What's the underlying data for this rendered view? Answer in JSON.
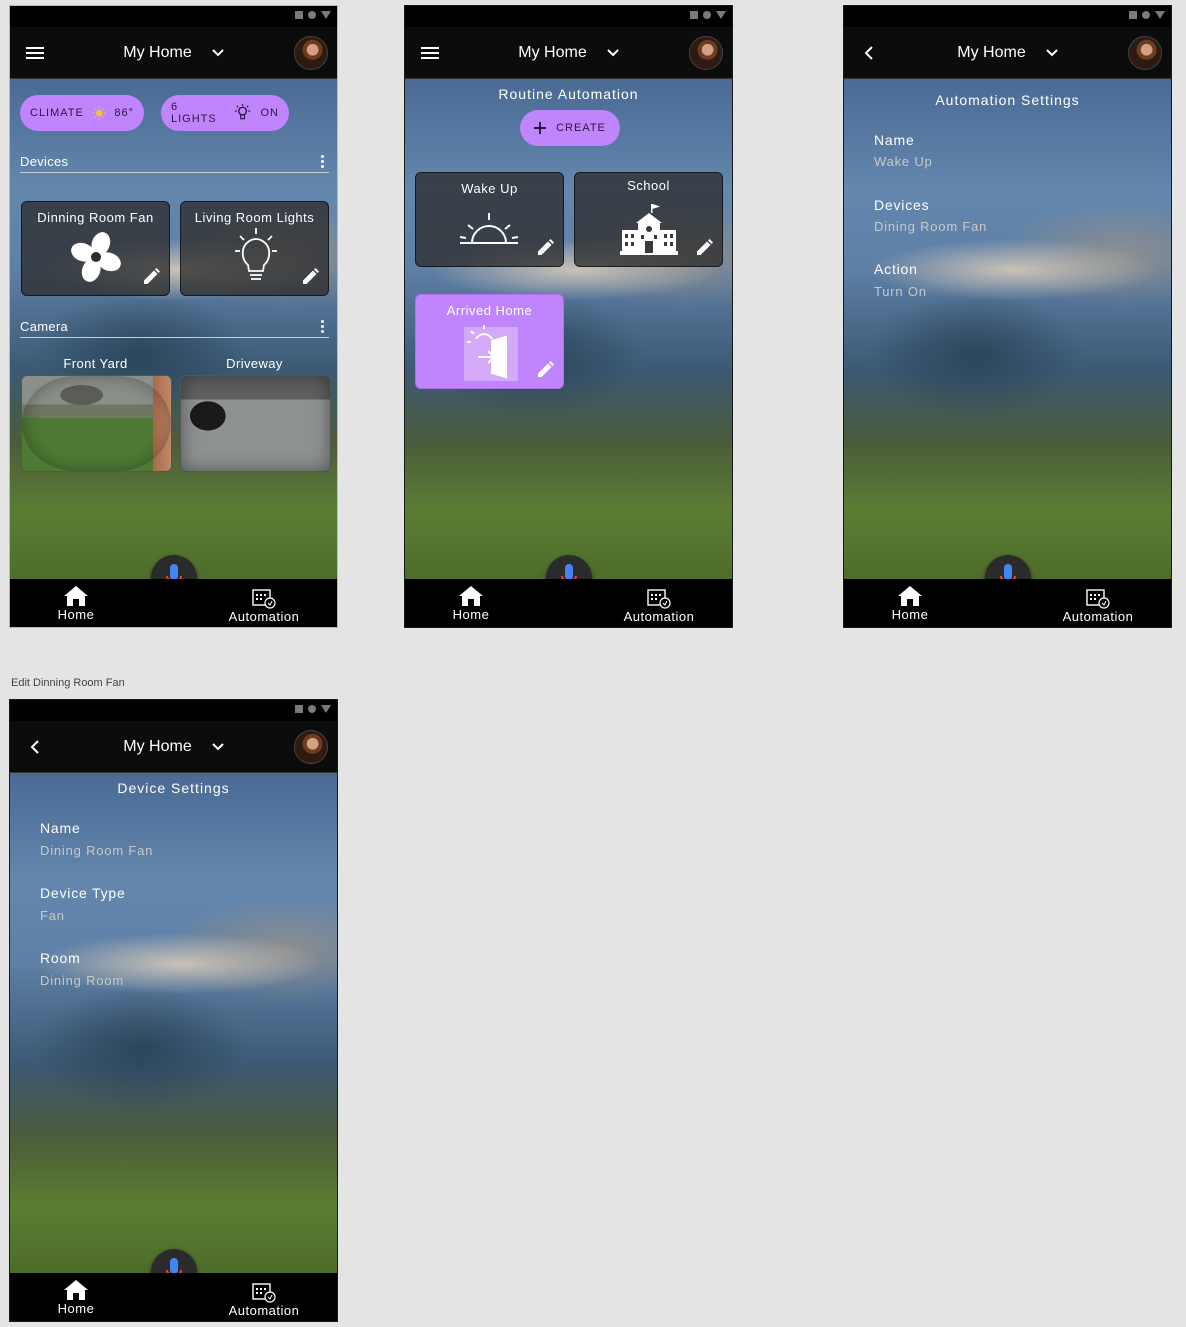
{
  "app": {
    "title": "My Home"
  },
  "bottom_nav": {
    "home": "Home",
    "automation": "Automation"
  },
  "home_screen": {
    "chips": [
      {
        "label": "CLIMATE",
        "value": "86°"
      },
      {
        "label": "6 LIGHTS",
        "value": "ON"
      }
    ],
    "devices_header": "Devices",
    "devices": [
      {
        "name": "Dinning Room Fan",
        "icon": "fan-icon"
      },
      {
        "name": "Living Room Lights",
        "icon": "lightbulb-icon"
      }
    ],
    "camera_header": "Camera",
    "cameras": [
      {
        "name": "Front Yard"
      },
      {
        "name": "Driveway"
      }
    ]
  },
  "automation_screen": {
    "title": "Routine Automation",
    "create_label": "CREATE",
    "routines": [
      {
        "name": "Wake Up",
        "icon": "sunrise-icon"
      },
      {
        "name": "School",
        "icon": "school-icon"
      },
      {
        "name": "Arrived Home",
        "icon": "door-enter-icon",
        "active": true
      }
    ]
  },
  "automation_settings": {
    "title": "Automation Settings",
    "fields": [
      {
        "label": "Name",
        "value": "Wake Up"
      },
      {
        "label": "Devices",
        "value": "Dining Room Fan"
      },
      {
        "label": "Action",
        "value": "Turn On"
      }
    ]
  },
  "device_settings": {
    "frame_caption": "Edit Dinning Room Fan",
    "title": "Device Settings",
    "fields": [
      {
        "label": "Name",
        "value": "Dining Room Fan"
      },
      {
        "label": "Device Type",
        "value": "Fan"
      },
      {
        "label": "Room",
        "value": "Dining Room"
      }
    ]
  },
  "colors": {
    "accent": "#c084fc",
    "bar": "#0c0c0c",
    "background": "#e4e4e4"
  }
}
